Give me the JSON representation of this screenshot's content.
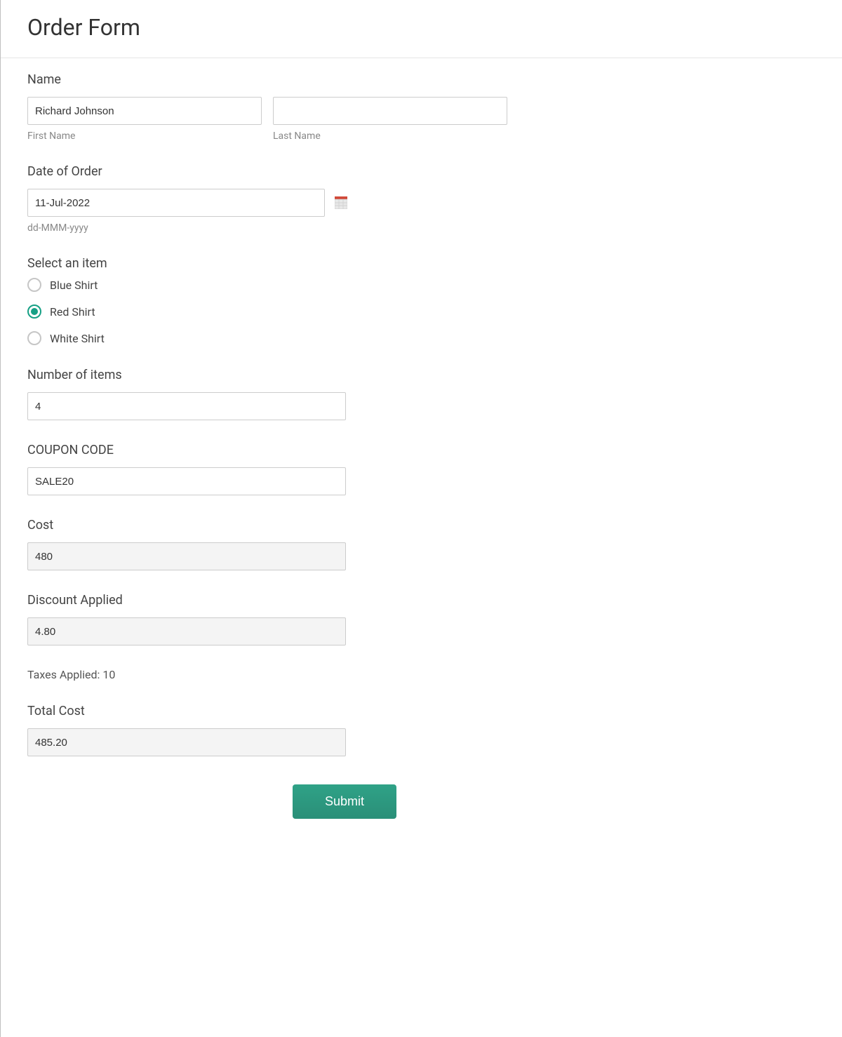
{
  "title": "Order Form",
  "name": {
    "label": "Name",
    "first_value": "Richard Johnson",
    "last_value": "",
    "first_sublabel": "First Name",
    "last_sublabel": "Last Name"
  },
  "date": {
    "label": "Date of Order",
    "value": "11-Jul-2022",
    "format_hint": "dd-MMM-yyyy"
  },
  "item": {
    "label": "Select an item",
    "options": [
      {
        "label": "Blue Shirt",
        "selected": false
      },
      {
        "label": "Red Shirt",
        "selected": true
      },
      {
        "label": "White Shirt",
        "selected": false
      }
    ]
  },
  "quantity": {
    "label": "Number of items",
    "value": "4"
  },
  "coupon": {
    "label": "COUPON CODE",
    "value": "SALE20"
  },
  "cost": {
    "label": "Cost",
    "value": "480"
  },
  "discount": {
    "label": "Discount Applied",
    "value": "4.80"
  },
  "taxes": {
    "text": "Taxes Applied: 10"
  },
  "total": {
    "label": "Total Cost",
    "value": "485.20"
  },
  "submit_label": "Submit",
  "colors": {
    "accent": "#2f9e82"
  }
}
